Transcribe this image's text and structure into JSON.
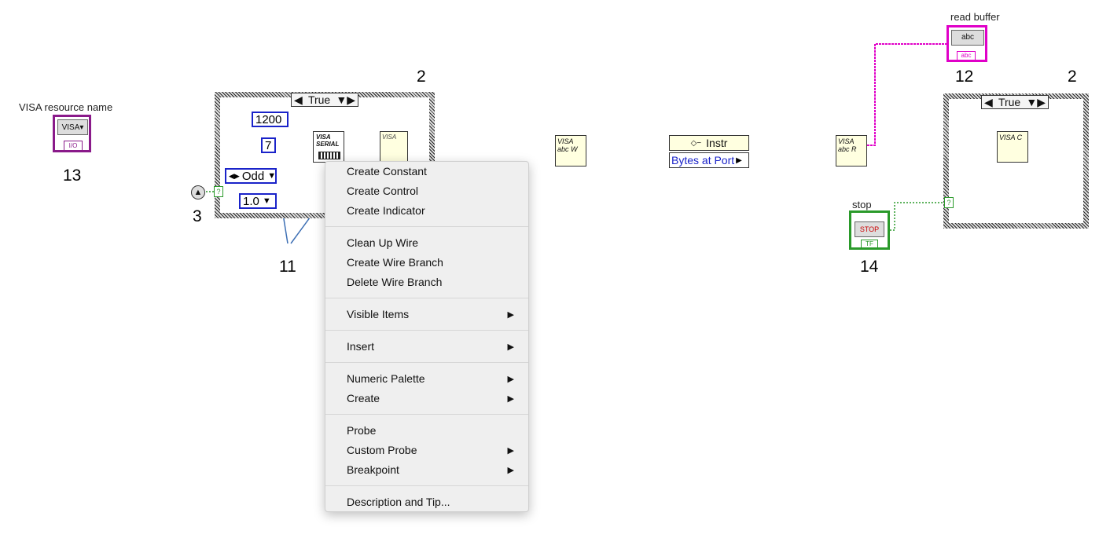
{
  "annotations": {
    "n13": "13",
    "n3": "3",
    "n11": "11",
    "n2_left": "2",
    "n2_right": "2",
    "n12": "12",
    "n14": "14"
  },
  "labels": {
    "visa_resource_name": "VISA resource name",
    "read_buffer": "read buffer",
    "stop": "stop"
  },
  "left_case": {
    "selector": "True",
    "const_baud": "1200",
    "const_bits": "7",
    "enum_parity": "Odd",
    "enum_stop": "1.0"
  },
  "right_case": {
    "selector": "True"
  },
  "property_node": {
    "class": "Instr",
    "property": "Bytes at Port"
  },
  "icons": {
    "visa_resource": "VISA",
    "visa_write": "VISA abc W",
    "visa_read": "VISA abc R",
    "visa_close": "VISA C",
    "string_indicator": "abc",
    "stop_button": "STOP",
    "tf": "TF",
    "io": "I/O",
    "serial": "VISA SERIAL"
  },
  "context_menu": {
    "groups": [
      [
        {
          "label": "Create Constant",
          "sub": false
        },
        {
          "label": "Create Control",
          "sub": false
        },
        {
          "label": "Create Indicator",
          "sub": false
        }
      ],
      [
        {
          "label": "Clean Up Wire",
          "sub": false
        },
        {
          "label": "Create Wire Branch",
          "sub": false
        },
        {
          "label": "Delete Wire Branch",
          "sub": false
        }
      ],
      [
        {
          "label": "Visible Items",
          "sub": true
        }
      ],
      [
        {
          "label": "Insert",
          "sub": true
        }
      ],
      [
        {
          "label": "Numeric Palette",
          "sub": true
        },
        {
          "label": "Create",
          "sub": true
        }
      ],
      [
        {
          "label": "Probe",
          "sub": false
        },
        {
          "label": "Custom Probe",
          "sub": true
        },
        {
          "label": "Breakpoint",
          "sub": true
        }
      ],
      [
        {
          "label": "Description and Tip...",
          "sub": false
        }
      ]
    ]
  },
  "colors": {
    "wire_blue": "#1a23c9",
    "wire_pink": "#e000c8",
    "wire_green": "#2a9a2a",
    "visa_purple": "#8a1a8a",
    "menu_bg": "#efefef"
  }
}
